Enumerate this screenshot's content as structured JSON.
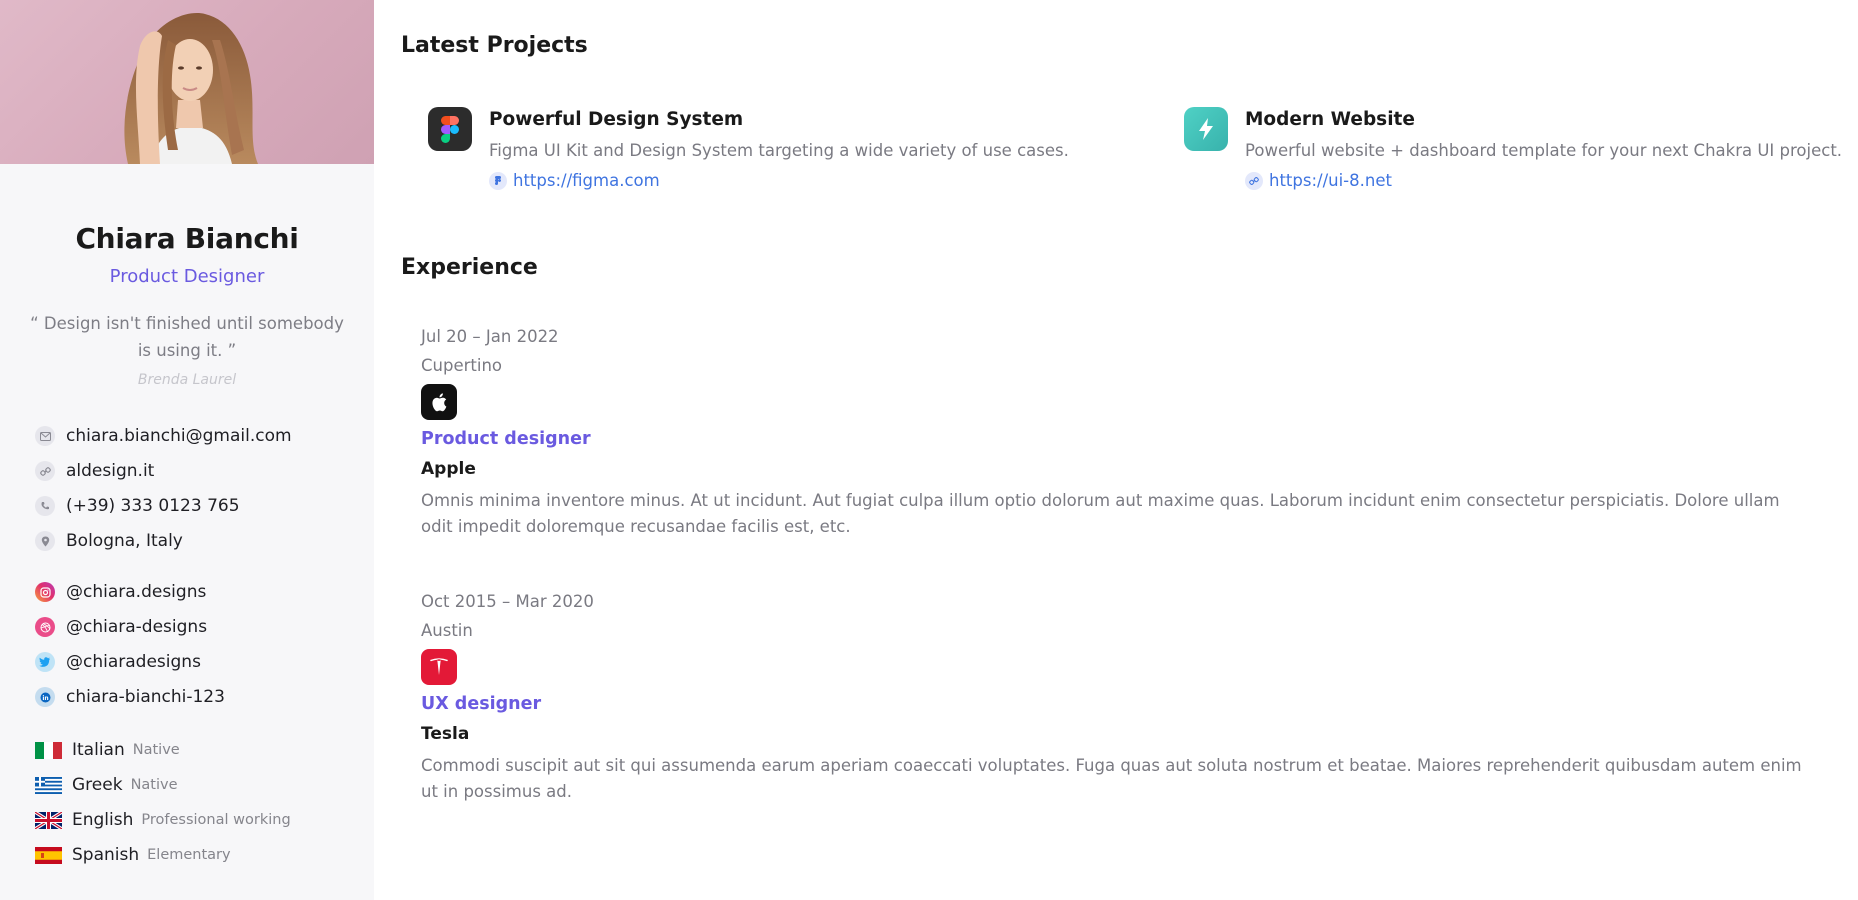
{
  "profile": {
    "name": "Chiara Bianchi",
    "role": "Product Designer",
    "quote": "“ Design isn't finished until somebody is using it. ”",
    "quote_author": "Brenda Laurel"
  },
  "contact": [
    {
      "icon": "mail-icon",
      "value": "chiara.bianchi@gmail.com"
    },
    {
      "icon": "link-icon",
      "value": "aldesign.it"
    },
    {
      "icon": "phone-icon",
      "value": "(+39) 333 0123 765"
    },
    {
      "icon": "location-pin-icon",
      "value": "Bologna, Italy"
    }
  ],
  "social": [
    {
      "icon": "instagram-icon",
      "value": "@chiara.designs",
      "color": "#e1306c"
    },
    {
      "icon": "dribbble-icon",
      "value": "@chiara-designs",
      "color": "#ea4c89"
    },
    {
      "icon": "twitter-icon",
      "value": "@chiaradesigns",
      "color": "#1da1f2"
    },
    {
      "icon": "linkedin-icon",
      "value": "chiara-bianchi-123",
      "color": "#0a66c2"
    }
  ],
  "languages": [
    {
      "flag": "italy-flag-icon",
      "name": "Italian",
      "level": "Native"
    },
    {
      "flag": "greece-flag-icon",
      "name": "Greek",
      "level": "Native"
    },
    {
      "flag": "uk-flag-icon",
      "name": "English",
      "level": "Professional working"
    },
    {
      "flag": "spain-flag-icon",
      "name": "Spanish",
      "level": "Elementary"
    }
  ],
  "projects": {
    "title": "Latest Projects",
    "items": [
      {
        "icon": "figma-icon",
        "title": "Powerful Design System",
        "description": "Figma UI Kit and Design System targeting a wide variety of use cases.",
        "link": "https://figma.com"
      },
      {
        "icon": "lightning-icon",
        "title": "Modern Website",
        "description": "Powerful website + dashboard template for your next Chakra UI project.",
        "link": "https://ui-8.net"
      }
    ]
  },
  "experience": {
    "title": "Experience",
    "items": [
      {
        "dates": "Jul 20 – Jan 2022",
        "location": "Cupertino",
        "logo": "apple-logo-icon",
        "role": "Product designer",
        "company": "Apple",
        "description": "Omnis minima inventore minus. At ut incidunt. Aut fugiat culpa illum optio dolorum aut maxime quas. Laborum incidunt enim consectetur perspiciatis. Dolore ullam odit impedit doloremque recusandae facilis est, etc."
      },
      {
        "dates": "Oct 2015 – Mar 2020",
        "location": "Austin",
        "logo": "tesla-logo-icon",
        "role": "UX designer",
        "company": "Tesla",
        "description": "Commodi suscipit aut sit qui assumenda earum aperiam coaeccati voluptates. Fuga quas aut soluta nostrum et beatae. Maiores reprehenderit quibusdam autem enim ut in possimus ad."
      }
    ]
  },
  "colors": {
    "accent": "#6a5ae0",
    "link": "#3f74e0",
    "sidebar_bg": "#f7f7f9"
  }
}
